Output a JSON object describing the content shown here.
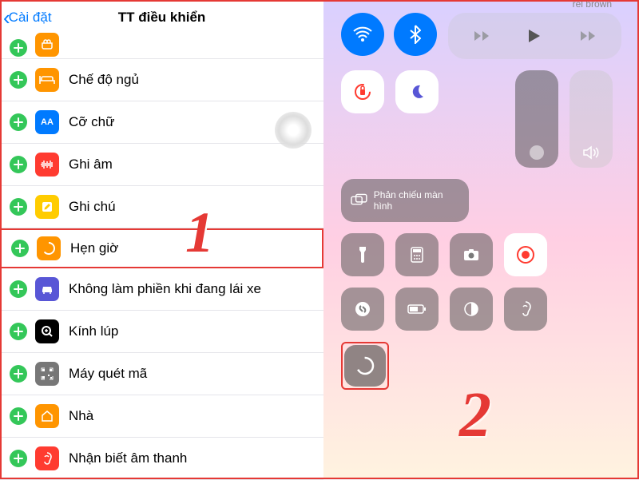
{
  "header": {
    "back": "Cài đặt",
    "title": "TT điều khiển"
  },
  "rows": [
    {
      "icon": "bed",
      "color": "#ff9500",
      "label": "Chế độ ngủ"
    },
    {
      "icon": "text",
      "color": "#007aff",
      "label": "Cỡ chữ"
    },
    {
      "icon": "wave",
      "color": "#ff3b30",
      "label": "Ghi âm"
    },
    {
      "icon": "note",
      "color": "#ffcc00",
      "label": "Ghi chú"
    },
    {
      "icon": "timer",
      "color": "#ff9500",
      "label": "Hẹn giờ"
    },
    {
      "icon": "car",
      "color": "#5856d6",
      "label": "Không làm phiền khi đang lái xe"
    },
    {
      "icon": "magnify",
      "color": "#000000",
      "label": "Kính lúp"
    },
    {
      "icon": "qr",
      "color": "#777777",
      "label": "Máy quét mã"
    },
    {
      "icon": "home",
      "color": "#ff9500",
      "label": "Nhà"
    },
    {
      "icon": "ear",
      "color": "#ff3b30",
      "label": "Nhận biết âm thanh"
    }
  ],
  "cc": {
    "media_text": "rel brown",
    "mirror_label": "Phản chiếu màn hình"
  },
  "annotations": {
    "step1": "1",
    "step2": "2"
  },
  "colors": {
    "accent": "#e53935",
    "ios_blue": "#007aff",
    "ios_green": "#34c759"
  }
}
